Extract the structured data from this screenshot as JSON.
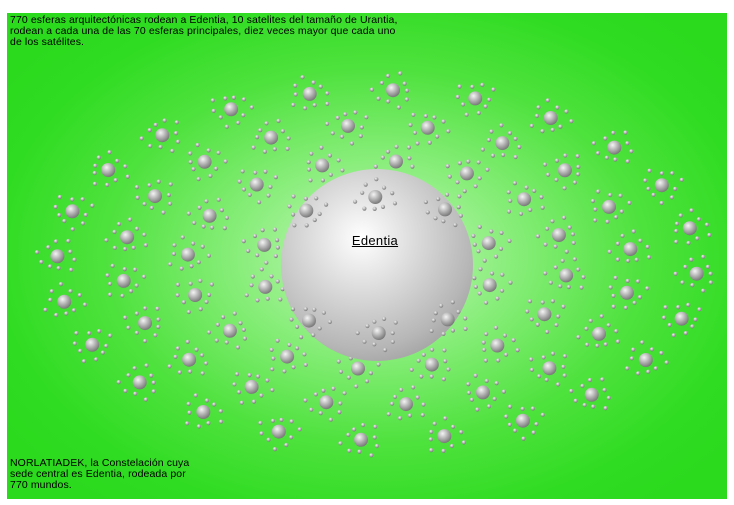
{
  "captions": {
    "top": "770 esferas arquitectónicas rodean a Edentia, 10 satelites del tamaño de Urantia,\nrodean a cada una de las 70 esferas principales, diez veces mayor que cada uno\nde los satélites.",
    "bottom": "NORLATIADEK, la Constelación cuya\nsede central es Edentia, rodeada por\n770 mundos."
  },
  "central_sphere": {
    "label": "Edentia"
  },
  "diagram": {
    "principal_spheres": 70,
    "satellites_per_sphere": 10,
    "total_spheres": 770,
    "colors": {
      "background_outer": "#2bd91d",
      "background_center": "#c8f5c0",
      "sphere_light": "#f4f4f4",
      "sphere_dark": "#6e6e6e"
    }
  }
}
